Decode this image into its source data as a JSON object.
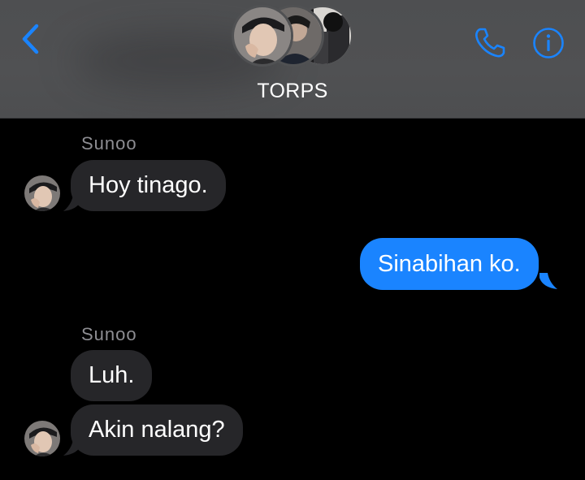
{
  "header": {
    "title": "TORPS",
    "back_icon": "chevron-left-icon",
    "call_icon": "phone-icon",
    "info_icon": "info-icon",
    "accent_color": "#1a84ff"
  },
  "messages": [
    {
      "sender": "Sunoo",
      "direction": "incoming",
      "text": "Hoy tinago."
    },
    {
      "direction": "outgoing",
      "text": "Sinabihan ko."
    },
    {
      "sender": "Sunoo",
      "direction": "incoming",
      "text": "Luh."
    },
    {
      "direction": "incoming",
      "text": "Akin nalang?"
    }
  ],
  "colors": {
    "background": "#000000",
    "header_background": "#505153",
    "incoming_bubble": "#262629",
    "outgoing_bubble": "#1a84ff",
    "sender_name": "#8e8e93"
  }
}
